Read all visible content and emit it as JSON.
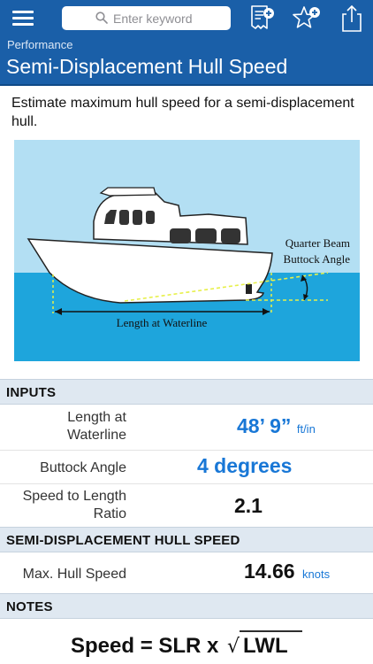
{
  "search": {
    "placeholder": "Enter keyword"
  },
  "header": {
    "category": "Performance",
    "title": "Semi-Displacement Hull Speed"
  },
  "description": "Estimate maximum hull speed for a semi-displacement hull.",
  "diagram": {
    "label_length": "Length at Waterline",
    "label_angle_line1": "Quarter Beam",
    "label_angle_line2": "Buttock Angle",
    "colors": {
      "sky": "#b3dff3",
      "water": "#1ea5dc",
      "hull": "#ffffff",
      "guide": "#e7f04a"
    }
  },
  "inputs": {
    "heading": "INPUTS",
    "length_label_1": "Length at",
    "length_label_2": "Waterline",
    "length_value": "48’ 9”",
    "length_unit": "ft/in",
    "angle_label": "Buttock Angle",
    "angle_value": "4 degrees",
    "slr_label_1": "Speed to Length",
    "slr_label_2": "Ratio",
    "slr_value": "2.1"
  },
  "results": {
    "heading": "SEMI-DISPLACEMENT HULL SPEED",
    "speed_label": "Max. Hull Speed",
    "speed_value": "14.66",
    "speed_unit": "knots"
  },
  "notes": {
    "heading": "NOTES",
    "formula_left": "Speed = SLR x ",
    "formula_sqrt": "√",
    "formula_var": "LWL"
  },
  "colors": {
    "brand": "#1a5fa8",
    "accent": "#1877d6",
    "section_bg": "#dfe8f1"
  }
}
